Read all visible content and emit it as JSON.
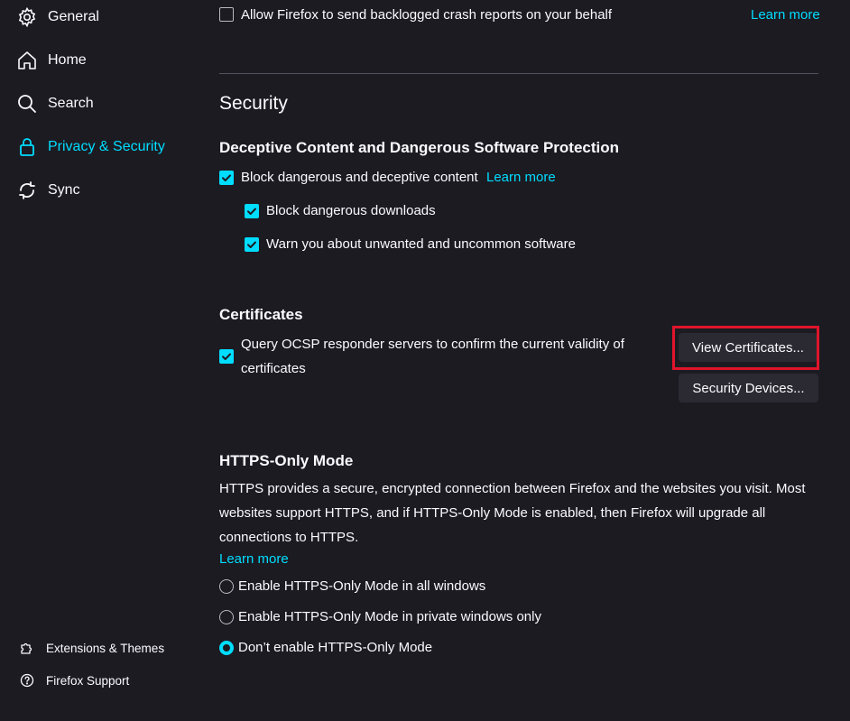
{
  "sidebar": {
    "items": [
      {
        "label": "General",
        "icon": "gear-icon"
      },
      {
        "label": "Home",
        "icon": "home-icon"
      },
      {
        "label": "Search",
        "icon": "search-icon"
      },
      {
        "label": "Privacy & Security",
        "icon": "lock-icon",
        "active": true
      },
      {
        "label": "Sync",
        "icon": "sync-icon"
      }
    ],
    "footer": [
      {
        "label": "Extensions & Themes",
        "icon": "puzzle-icon"
      },
      {
        "label": "Firefox Support",
        "icon": "help-icon"
      }
    ]
  },
  "crash_reports": {
    "label": "Allow Firefox to send backlogged crash reports on your behalf",
    "checked": false,
    "learn_more": "Learn more"
  },
  "security": {
    "title": "Security",
    "deceptive": {
      "heading": "Deceptive Content and Dangerous Software Protection",
      "block_content": {
        "label": "Block dangerous and deceptive content",
        "checked": true,
        "learn_more": "Learn more"
      },
      "block_downloads": {
        "label": "Block dangerous downloads",
        "checked": true
      },
      "warn_unwanted": {
        "label": "Warn you about unwanted and uncommon software",
        "checked": true
      }
    },
    "certificates": {
      "heading": "Certificates",
      "ocsp_line1": "Query OCSP responder servers to confirm the current validity of",
      "ocsp_line2": "certificates",
      "ocsp_checked": true,
      "view_button": "View Certificates...",
      "devices_button": "Security Devices..."
    },
    "https_only": {
      "heading": "HTTPS-Only Mode",
      "description": "HTTPS provides a secure, encrypted connection between Firefox and the websites you visit. Most websites support HTTPS, and if HTTPS-Only Mode is enabled, then Firefox will upgrade all connections to HTTPS.",
      "learn_more": "Learn more",
      "options": [
        {
          "label": "Enable HTTPS-Only Mode in all windows",
          "selected": false
        },
        {
          "label": "Enable HTTPS-Only Mode in private windows only",
          "selected": false
        },
        {
          "label": "Don’t enable HTTPS-Only Mode",
          "selected": true
        }
      ]
    }
  },
  "colors": {
    "background": "#1c1b22",
    "accent": "#00ddff",
    "button": "#2b2a33",
    "highlight": "#e0142b"
  }
}
